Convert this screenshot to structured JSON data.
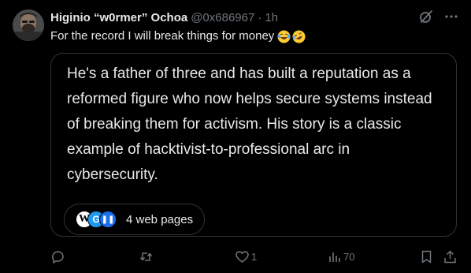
{
  "post": {
    "display_name": "Higinio “w0rmer” Ochoa",
    "handle": "@0x686967",
    "separator": "·",
    "time": "1h",
    "text": "For the record I will break things for money",
    "emojis": [
      "face-with-tears-of-joy",
      "rolling-on-the-floor-laughing"
    ]
  },
  "grok_card": {
    "text": "He's a father of three and has built a reputation as a reformed figure who now helps secure systems instead of breaking them for activism. His story is a classic example of hacktivist-to-professional arc in cybersecurity.",
    "sources_label": "4 web pages",
    "source_icons": [
      {
        "name": "wikipedia-icon",
        "glyph": "W"
      },
      {
        "name": "g-source-icon",
        "glyph": "G"
      },
      {
        "name": "pause-source-icon",
        "glyph": "❚❚"
      }
    ]
  },
  "actions": {
    "reply_count": "",
    "repost_count": "",
    "like_count": "1",
    "views_count": "70"
  },
  "colors": {
    "background": "#000000",
    "text": "#e7e9ea",
    "muted": "#71767b",
    "border": "#2f3336",
    "accent": "#1d9bf0"
  }
}
